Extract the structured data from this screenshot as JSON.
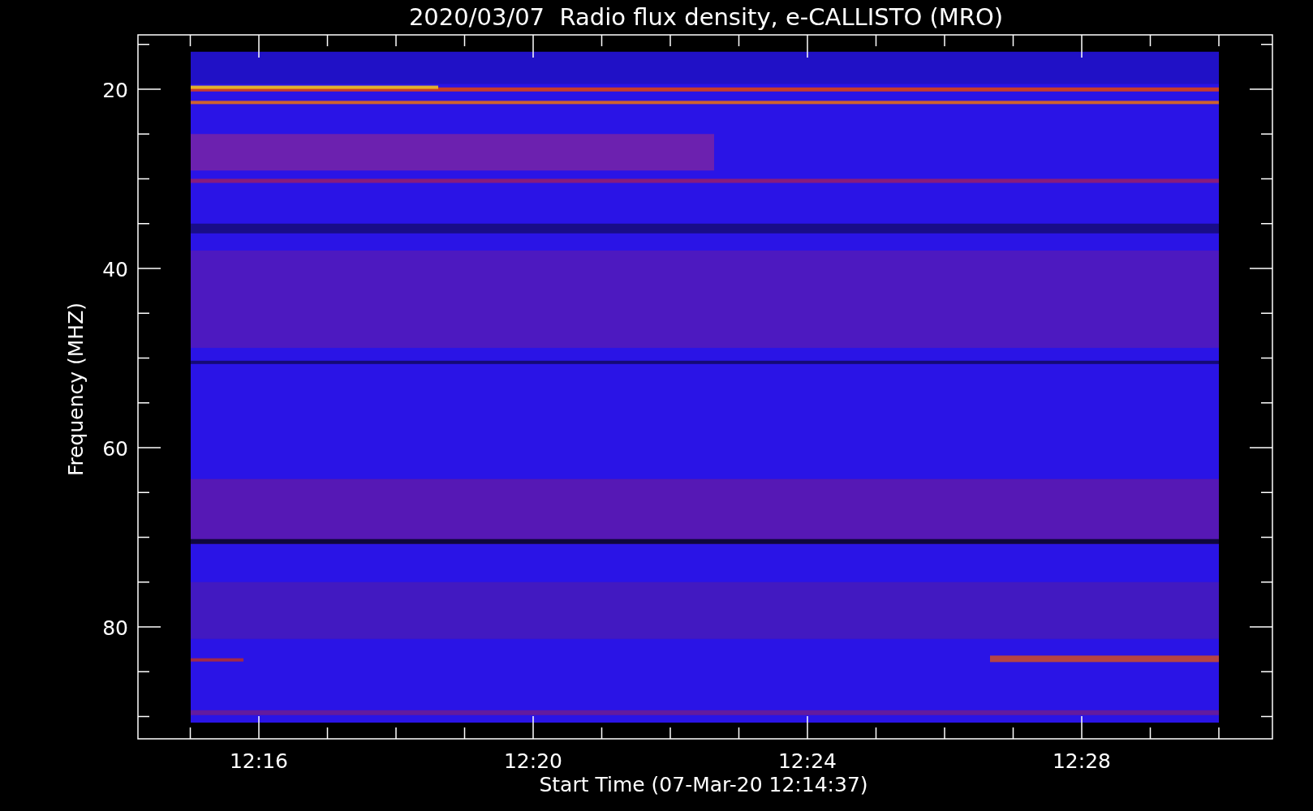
{
  "plot": {
    "title": "2020/03/07  Radio flux density, e-CALLISTO (MRO)",
    "xlabel": "Start Time (07-Mar-20 12:14:37)",
    "ylabel": "Frequency (MHZ)",
    "xticks": [
      "12:16",
      "12:20",
      "12:24",
      "12:28"
    ],
    "yticks": [
      "20",
      "40",
      "60",
      "80"
    ]
  }
}
